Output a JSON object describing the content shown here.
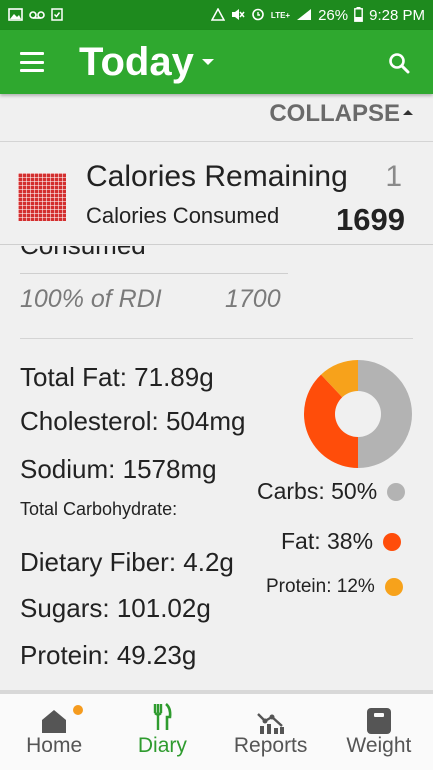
{
  "status_bar": {
    "battery": "26%",
    "time": "9:28 PM",
    "network": "LTE+"
  },
  "app_bar": {
    "title": "Today"
  },
  "collapse_label": "COLLAPSE",
  "calories": {
    "remaining_label": "Calories Remaining",
    "remaining_value": "1",
    "consumed_label": "Calories Consumed",
    "consumed_value": "1699"
  },
  "consumed_partial": "Consumed",
  "rdi": {
    "label": "100% of RDI",
    "value": "1700"
  },
  "nutrients": {
    "total_fat": "Total Fat: 71.89g",
    "cholesterol": "Cholesterol: 504mg",
    "sodium": "Sodium: 1578mg",
    "total_carbohydrate": "Total Carbohydrate:",
    "dietary_fiber": "Dietary Fiber: 4.2g",
    "sugars": "Sugars: 101.02g",
    "protein": "Protein: 49.23g"
  },
  "macros": {
    "carbs": {
      "label": "Carbs: 50%",
      "percent": 50,
      "color": "#b3b3b3"
    },
    "fat": {
      "label": "Fat: 38%",
      "percent": 38,
      "color": "#ff4d0a"
    },
    "protein": {
      "label": "Protein: 12%",
      "percent": 12,
      "color": "#f7a21b"
    }
  },
  "bottom_nav": {
    "home": "Home",
    "diary": "Diary",
    "reports": "Reports",
    "weight": "Weight"
  },
  "colors": {
    "status_bar": "#1e8a1e",
    "app_bar": "#2fa82f",
    "active_tab": "#2e9b2e",
    "notification_dot": "#f59b1e"
  }
}
